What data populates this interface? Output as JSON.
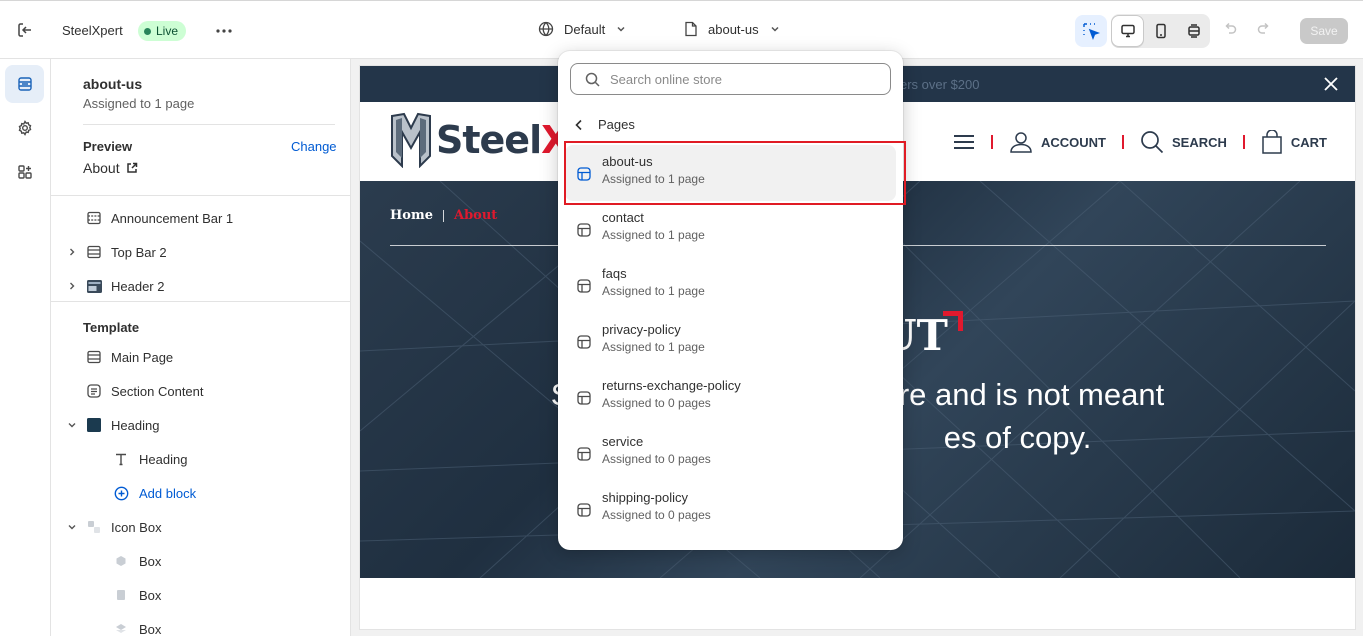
{
  "topbar": {
    "store_name": "SteelXpert",
    "live_label": "Live",
    "theme_select": "Default",
    "page_select": "about-us",
    "save_label": "Save"
  },
  "sidebar": {
    "title": "about-us",
    "subtitle": "Assigned to 1 page",
    "preview_label": "Preview",
    "preview_change": "Change",
    "preview_value": "About",
    "header_sections": [
      "Announcement Bar 1",
      "Top Bar 2",
      "Header 2"
    ],
    "template_label": "Template",
    "template_items": [
      "Main Page",
      "Section Content",
      "Heading",
      "Heading",
      "Add block",
      "Icon Box",
      "Box",
      "Box",
      "Box"
    ]
  },
  "site": {
    "announcement": "ers over $200",
    "logo_text": "Steel",
    "logo_accent": "X",
    "nav": {
      "account": "ACCOUNT",
      "search": "SEARCH",
      "cart": "CART"
    },
    "crumb_home": "Home",
    "crumb_current": "About",
    "hero_title_fragment": "UT",
    "hero_line1": "Sup                              here and is not meant",
    "hero_line2": "es of copy."
  },
  "dropdown": {
    "search_placeholder": "Search online store",
    "back_label": "Pages",
    "items": [
      {
        "name": "about-us",
        "meta": "Assigned to 1 page"
      },
      {
        "name": "contact",
        "meta": "Assigned to 1 page"
      },
      {
        "name": "faqs",
        "meta": "Assigned to 1 page"
      },
      {
        "name": "privacy-policy",
        "meta": "Assigned to 1 page"
      },
      {
        "name": "returns-exchange-policy",
        "meta": "Assigned to 0 pages"
      },
      {
        "name": "service",
        "meta": "Assigned to 0 pages"
      },
      {
        "name": "shipping-policy",
        "meta": "Assigned to 0 pages"
      }
    ]
  },
  "colors": {
    "accent_blue": "#005bd3",
    "brand_red": "#e0192e",
    "brand_navy": "#2d3b4d",
    "highlight_red": "#e01b24",
    "live_green": "#29845a"
  }
}
